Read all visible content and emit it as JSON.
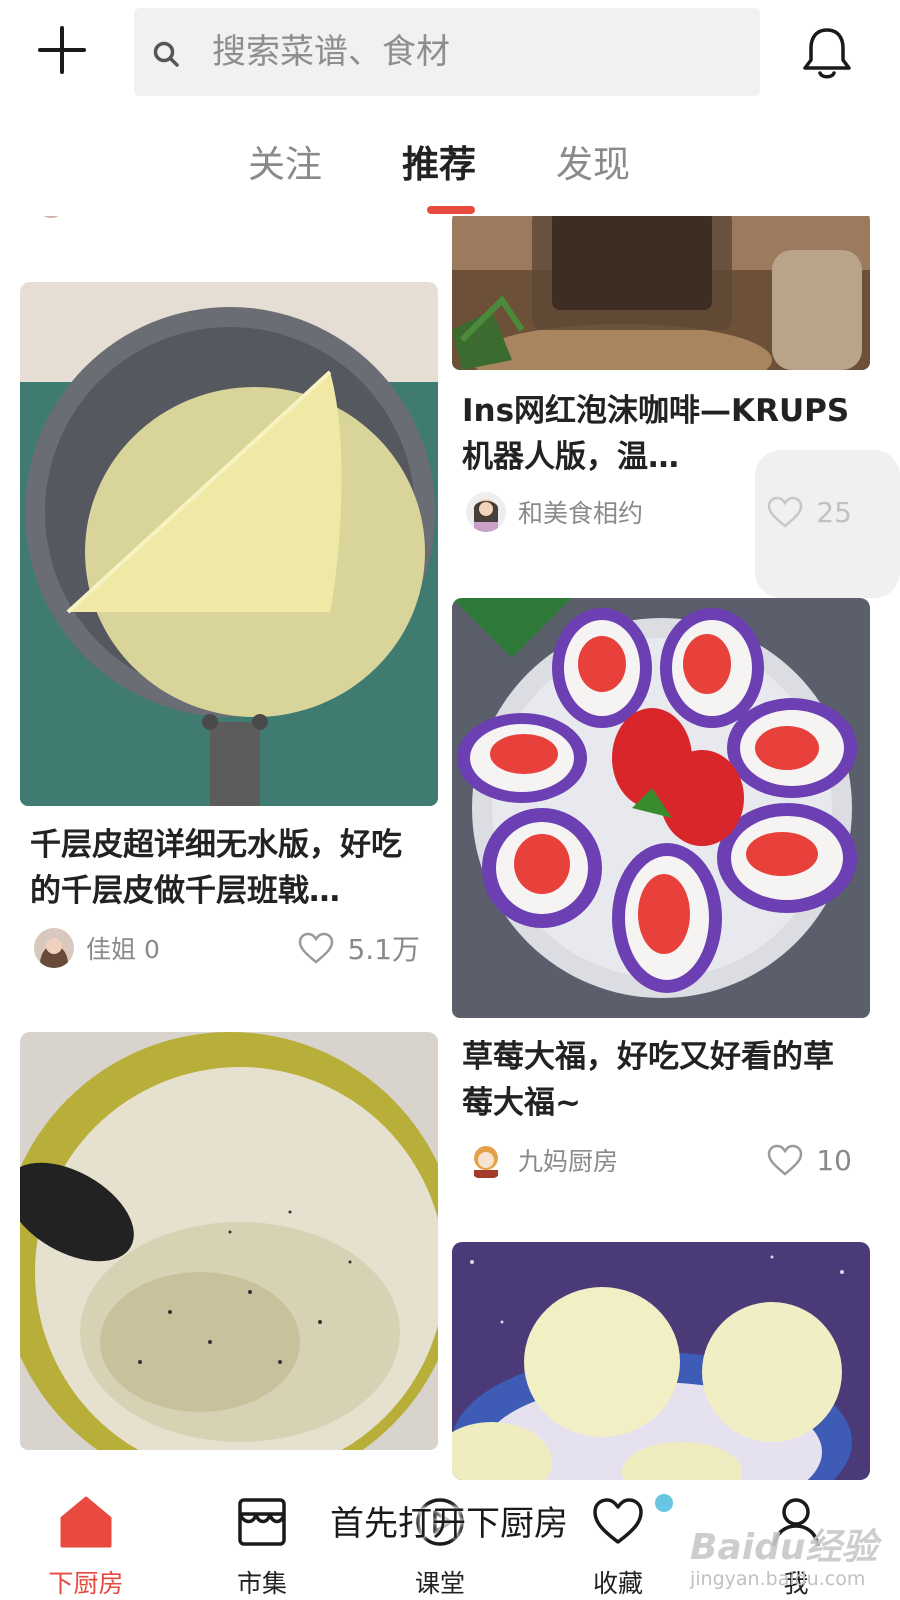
{
  "header": {
    "search": {
      "placeholder": "搜索菜谱、食材",
      "value": ""
    }
  },
  "tabs": [
    {
      "label": "关注",
      "active": false
    },
    {
      "label": "推荐",
      "active": true
    },
    {
      "label": "发现",
      "active": false
    }
  ],
  "cards": [
    {
      "title": "Ins网红泡沫咖啡—KRUPS机器人版，温…",
      "author": "和美食相约",
      "likes": "25"
    },
    {
      "title": "千层皮超详细无水版，好吃的千层皮做千层班戟…",
      "author": "佳姐 0",
      "likes": "5.1万"
    },
    {
      "title": "草莓大福，好吃又好看的草莓大福~",
      "author": "九妈厨房",
      "likes": "10"
    },
    {
      "title": "",
      "author": "",
      "likes": ""
    },
    {
      "title": "",
      "author": "",
      "likes": ""
    }
  ],
  "bottom_nav": [
    {
      "label": "下厨房",
      "icon": "home-icon",
      "active": true
    },
    {
      "label": "市集",
      "icon": "shop-icon",
      "active": false
    },
    {
      "label": "课堂",
      "icon": "play-icon",
      "active": false
    },
    {
      "label": "收藏",
      "icon": "heart-icon",
      "active": false
    },
    {
      "label": "我",
      "icon": "person-icon",
      "active": false
    }
  ],
  "overlay": {
    "subtitle": "首先打开下厨房",
    "watermark_title": "Baidu经验",
    "watermark_url": "jingyan.baidu.com"
  },
  "colors": {
    "accent": "#e84a3f",
    "text": "#222222",
    "muted": "#8a8a8a",
    "search_bg": "#f1f1f1"
  }
}
